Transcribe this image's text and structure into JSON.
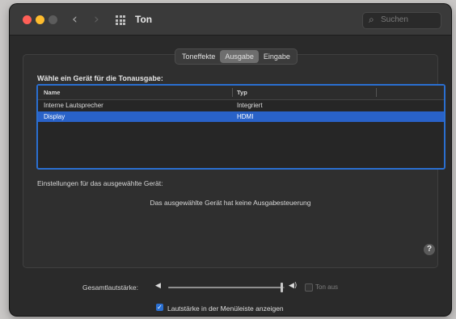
{
  "window": {
    "title": "Ton"
  },
  "toolbar": {
    "back_glyph": "‹",
    "forward_glyph": "›",
    "search_glyph": "⌕",
    "search_placeholder": "Suchen"
  },
  "tabs": [
    {
      "label": "Toneffekte",
      "active": false
    },
    {
      "label": "Ausgabe",
      "active": true
    },
    {
      "label": "Eingabe",
      "active": false
    }
  ],
  "output": {
    "choose_label": "Wähle ein Gerät für die Tonausgabe:",
    "columns": [
      "Name",
      "Typ"
    ],
    "devices": [
      {
        "name": "Interne Lautsprecher",
        "type": "Integriert",
        "selected": false
      },
      {
        "name": "Display",
        "type": "HDMI",
        "selected": true
      }
    ],
    "settings_label": "Einstellungen für das ausgewählte Gerät:",
    "no_control_message": "Das ausgewählte Gerät hat keine Ausgabesteuerung",
    "help_glyph": "?"
  },
  "volume": {
    "label": "Gesamtlautstärke:",
    "level": 0.98,
    "low_icon": "◀",
    "high_icon": "◀)",
    "mute_label": "Ton aus",
    "mute_checked": false,
    "menu_bar_label": "Lautstärke in der Menüleiste anzeigen",
    "menu_bar_checked": true,
    "check_glyph": "✓"
  },
  "colors": {
    "accent": "#2a6fd1",
    "selection": "#2962c8",
    "close": "#ff5f57",
    "minimize": "#febc2e"
  }
}
